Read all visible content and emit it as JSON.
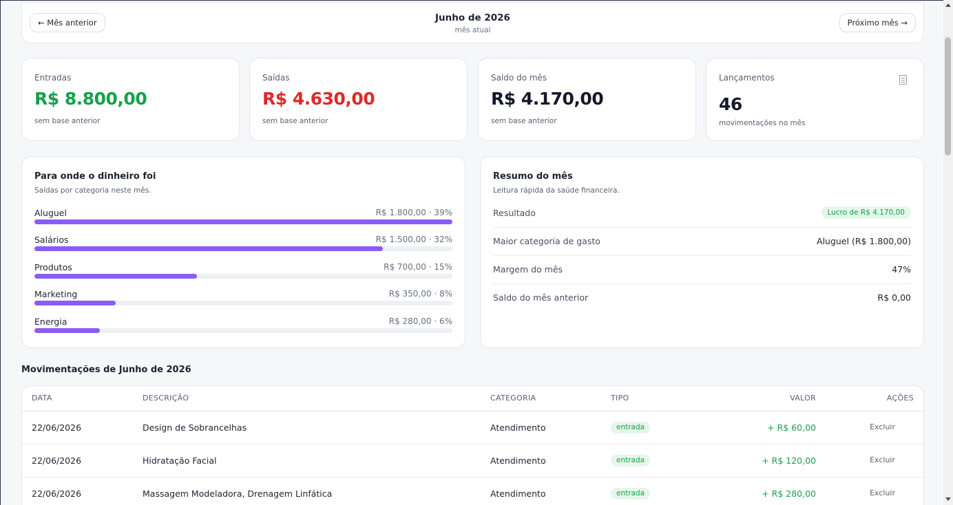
{
  "header": {
    "prev_label": "← Mês anterior",
    "next_label": "Próximo mês →",
    "title": "Junho de 2026",
    "subtitle": "mês atual"
  },
  "stats": [
    {
      "label": "Entradas",
      "value": "R$ 8.800,00",
      "note": "sem base anterior",
      "color": "#17a04a"
    },
    {
      "label": "Saídas",
      "value": "R$ 4.630,00",
      "note": "sem base anterior",
      "color": "#dd2a2a"
    },
    {
      "label": "Saldo do mês",
      "value": "R$ 4.170,00",
      "note": "sem base anterior",
      "color": "#14182a"
    },
    {
      "label": "Lançamentos",
      "value": "46",
      "note": "movimentações no mês",
      "icon": "document-icon"
    }
  ],
  "categories_panel": {
    "title": "Para onde o dinheiro foi",
    "subtitle": "Saídas por categoria neste mês.",
    "bar_color": "#8b5cf6",
    "items": [
      {
        "name": "Aluguel",
        "value": "R$ 1.800,00 · 39%",
        "fill": 1.0
      },
      {
        "name": "Salários",
        "value": "R$ 1.500,00 · 32%",
        "fill": 0.833
      },
      {
        "name": "Produtos",
        "value": "R$ 700,00 · 15%",
        "fill": 0.389
      },
      {
        "name": "Marketing",
        "value": "R$ 350,00 · 8%",
        "fill": 0.194
      },
      {
        "name": "Energia",
        "value": "R$ 280,00 · 6%",
        "fill": 0.156
      }
    ]
  },
  "summary_panel": {
    "title": "Resumo do mês",
    "subtitle": "Leitura rápida da saúde financeira.",
    "rows": [
      {
        "key": "Resultado",
        "value": "Lucro de R$ 4.170,00"
      },
      {
        "key": "Maior categoria de gasto",
        "value": "Aluguel (R$ 1.800,00)"
      },
      {
        "key": "Margem do mês",
        "value": "47%"
      },
      {
        "key": "Saldo do mês anterior",
        "value": "R$ 0,00"
      }
    ]
  },
  "transactions": {
    "title": "Movimentações de Junho de 2026",
    "columns": [
      "DATA",
      "DESCRIÇÃO",
      "CATEGORIA",
      "TIPO",
      "VALOR",
      "AÇÕES"
    ],
    "rows": [
      {
        "date": "22/06/2026",
        "description": "Design de Sobrancelhas",
        "category": "Atendimento",
        "type": "entrada",
        "value": "+ R$ 60,00",
        "action": "Excluir"
      },
      {
        "date": "22/06/2026",
        "description": "Hidratação Facial",
        "category": "Atendimento",
        "type": "entrada",
        "value": "+ R$ 120,00",
        "action": "Excluir"
      },
      {
        "date": "22/06/2026",
        "description": "Massagem Modeladora, Drenagem Linfática",
        "category": "Atendimento",
        "type": "entrada",
        "value": "+ R$ 280,00",
        "action": "Excluir"
      }
    ]
  }
}
